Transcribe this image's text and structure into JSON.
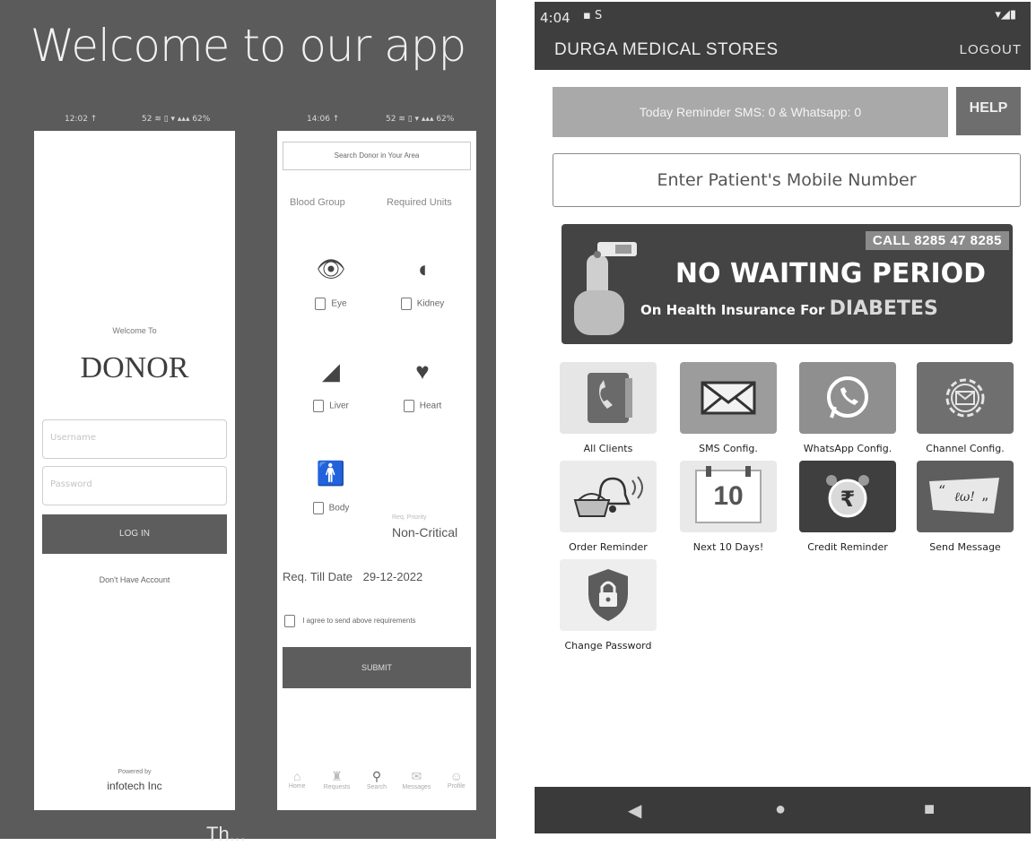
{
  "left": {
    "title": "Welcome to our app",
    "status_a": "12:02 ↑",
    "status_b": "52 ≋ ▯ ▾ ▴▴▴ 62%",
    "status_c": "14:06 ↑",
    "status_d": "52 ≋ ▯ ▾ ▴▴▴ 62%",
    "donor_screen": {
      "welcome_to": "Welcome To",
      "app_name": "DONOR",
      "username_placeholder": "Username",
      "password_placeholder": "Password",
      "login_label": "LOG IN",
      "no_account": "Don't Have Account",
      "powered_by": "Powered by",
      "company": "infotech Inc"
    },
    "search_screen": {
      "search_placeholder": "Search Donor in Your Area",
      "col_blood_group": "Blood Group",
      "col_required_units": "Required Units",
      "organs": [
        "Eye",
        "Kidney",
        "Liver",
        "Heart",
        "Body"
      ],
      "priority_label": "Req. Priority",
      "priority_value": "Non-Critical",
      "req_till_label": "Req. Till Date",
      "req_till_value": "29-12-2022",
      "agree_text": "I agree to send above requirements",
      "submit_label": "SUBMIT",
      "nav": [
        "Home",
        "Requests",
        "Search",
        "Messages",
        "Profile"
      ]
    },
    "bottom_text": "Th..."
  },
  "right": {
    "status_time": "4:04",
    "status_left_icons": "▪ S",
    "status_right_icons": "▾◢▮",
    "app_title": "DURGA MEDICAL STORES",
    "logout_label": "LOGOUT",
    "reminder_text": "Today Reminder SMS: 0 & Whatsapp: 0",
    "help_label": "HELP",
    "mobile_placeholder": "Enter Patient's Mobile Number",
    "banner": {
      "call": "CALL 8285 47 8285",
      "headline": "NO WAITING PERIOD",
      "sub": "On Health Insurance For",
      "sub_highlight": "DIABETES"
    },
    "tiles": [
      {
        "label": "All Clients",
        "icon": "phone-book-icon"
      },
      {
        "label": "SMS Config.",
        "icon": "envelope-icon"
      },
      {
        "label": "WhatsApp Config.",
        "icon": "whatsapp-icon"
      },
      {
        "label": "Channel Config.",
        "icon": "gear-envelope-icon"
      },
      {
        "label": "Order Reminder",
        "icon": "basket-bell-icon"
      },
      {
        "label": "Next 10 Days!",
        "icon": "calendar-10-icon",
        "badge": "10"
      },
      {
        "label": "Credit Reminder",
        "icon": "rupee-alarm-icon"
      },
      {
        "label": "Send Message",
        "icon": "quote-message-icon"
      },
      {
        "label": "Change Password",
        "icon": "lock-shield-icon"
      }
    ]
  }
}
